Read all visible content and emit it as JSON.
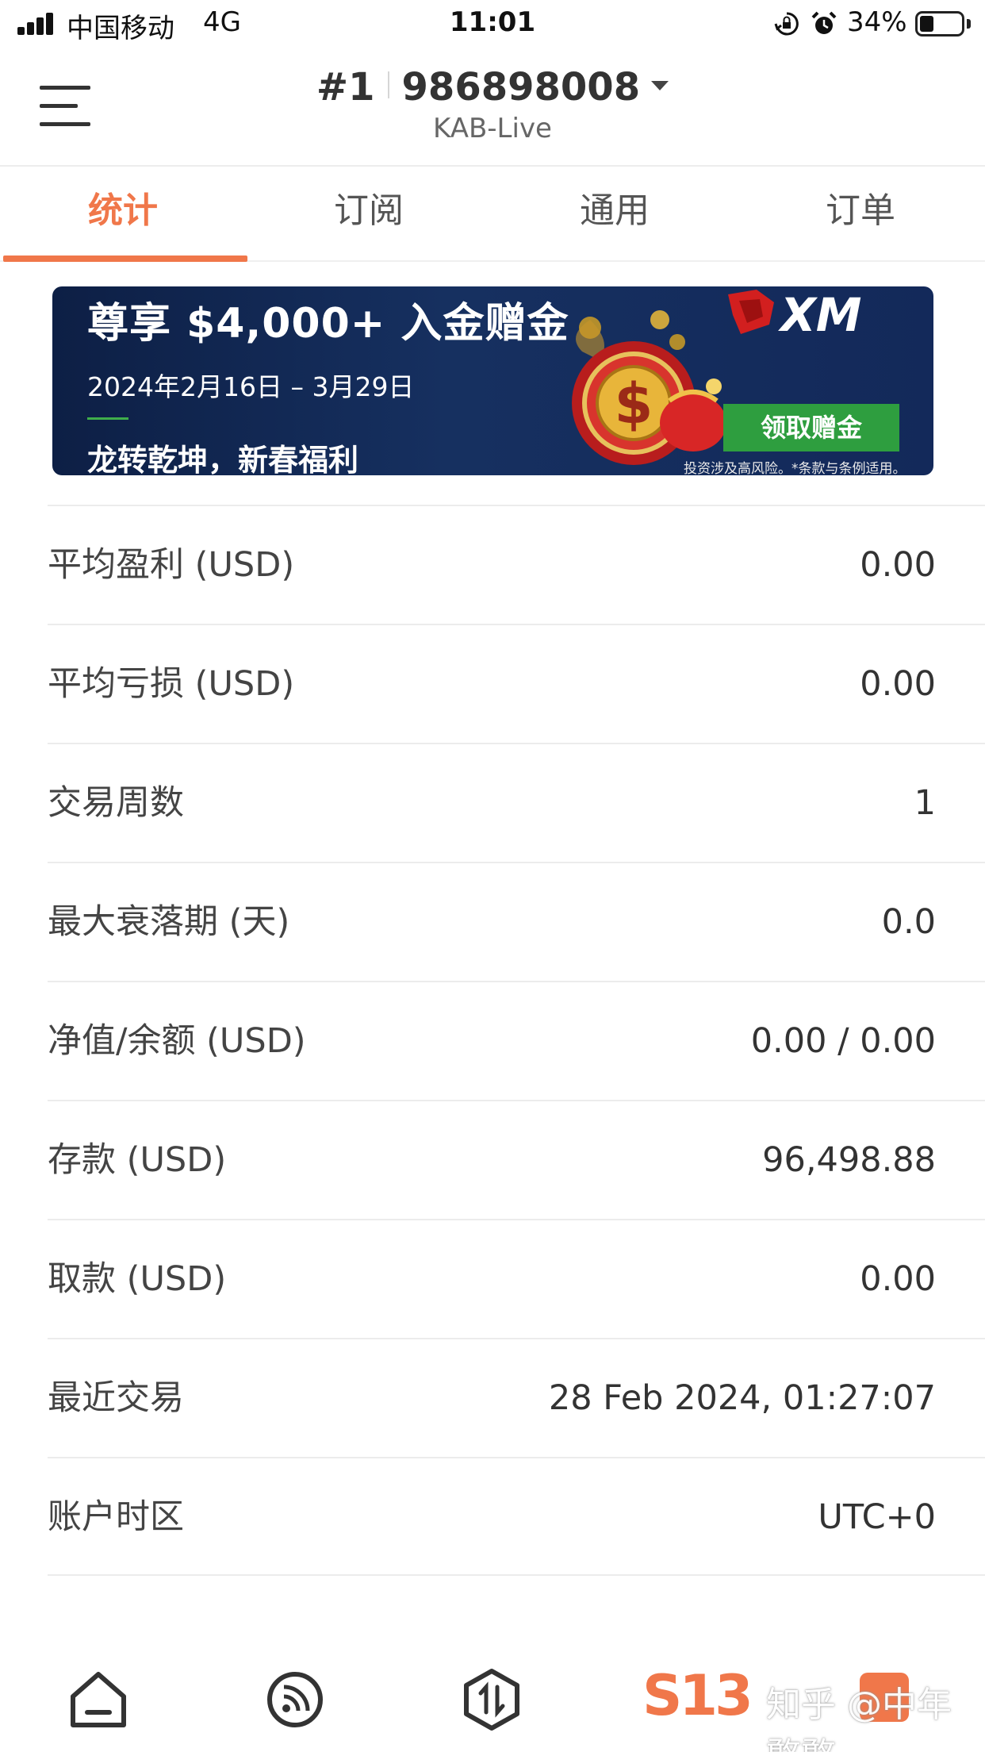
{
  "status_bar": {
    "carrier": "中国移动",
    "network": "4G",
    "time": "11:01",
    "battery_percent": "34%",
    "battery_level": 0.34,
    "icons": [
      "signal-icon",
      "orientation-lock-icon",
      "alarm-icon",
      "battery-icon"
    ]
  },
  "header": {
    "account_index": "#1",
    "account_number": "986898008",
    "server": "KAB-Live",
    "icons": [
      "menu-icon",
      "dropdown-caret-icon"
    ]
  },
  "tabs": [
    {
      "label": "统计",
      "active": true
    },
    {
      "label": "订阅",
      "active": false
    },
    {
      "label": "通用",
      "active": false
    },
    {
      "label": "订单",
      "active": false
    }
  ],
  "banner": {
    "headline": "尊享 $4,000+ 入金赠金",
    "dates": "2024年2月16日 – 3月29日",
    "slogan": "龙转乾坤，新春福利",
    "brand": "XM",
    "button": "领取赠金",
    "disclaimer": "投资涉及高风险。*条款与条例适用。"
  },
  "stats": [
    {
      "label": "平均盈利 (USD)",
      "value": "0.00"
    },
    {
      "label": "平均亏损 (USD)",
      "value": "0.00"
    },
    {
      "label": "交易周数",
      "value": "1"
    },
    {
      "label": "最大衰落期 (天)",
      "value": "0.0"
    },
    {
      "label": "净值/余额 (USD)",
      "value": "0.00 / 0.00"
    },
    {
      "label": "存款 (USD)",
      "value": "96,498.88"
    },
    {
      "label": "取款 (USD)",
      "value": "0.00"
    },
    {
      "label": "最近交易",
      "value": "28 Feb 2024, 01:27:07"
    },
    {
      "label": "账户时区",
      "value": "UTC+0"
    }
  ],
  "bottom_nav": {
    "items": [
      "home-icon",
      "feed-icon",
      "trade-icon",
      "s13-icon"
    ],
    "s13_label": "S13",
    "watermark": "知乎 @中年憨憨"
  },
  "colors": {
    "accent": "#f0774a",
    "banner_bg": "#13295a",
    "banner_button": "#2e9e3f"
  }
}
